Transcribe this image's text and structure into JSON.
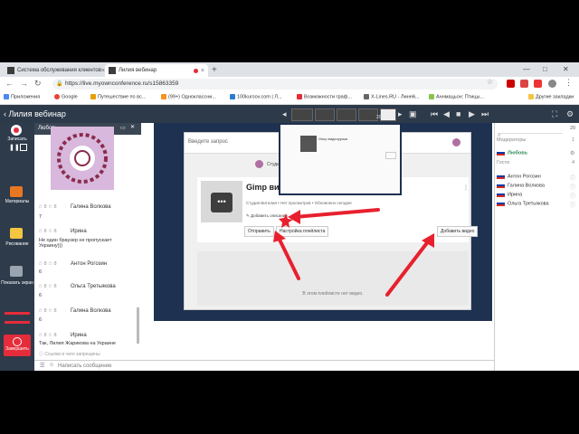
{
  "browser": {
    "tabs": [
      {
        "title": "Система обслуживания клиентов",
        "active": false
      },
      {
        "title": "Лилия вебинар",
        "active": true
      }
    ],
    "url": "https://live.myownconference.ru/s15863359",
    "bookmarks": [
      "Приложения",
      "Google",
      "Путешествие по вс...",
      "(99+) Одноклассни...",
      "100kursov.com | Л...",
      "Возможности граф...",
      "X-Lines.RU - Линей...",
      "Аннмацьон: Птицы...",
      "Другие закладки"
    ]
  },
  "app": {
    "title": "Лилия вебинар",
    "page_counter": "20",
    "left_toolbar": [
      "Записать",
      "Материалы",
      "Рисование",
      "Показать экран",
      "Завершить"
    ]
  },
  "chat": {
    "header": "Любовь",
    "messages": [
      {
        "name": "Галина Волкова",
        "text": "7"
      },
      {
        "name": "Ирина",
        "text": "Не один браузер не пропускает Украину)))"
      },
      {
        "name": "Антон Рогозин",
        "text": "6"
      },
      {
        "name": "Ольга Третьякова",
        "text": "6"
      },
      {
        "name": "Галина Волкова",
        "text": "6"
      },
      {
        "name": "Ирина",
        "text": "Так, Лилия Жарикова на Украине"
      }
    ],
    "footer_note": "Ссылки в чате запрещены",
    "input_placeholder": "Написать сообщение"
  },
  "slide": {
    "search_placeholder": "Введите запрос",
    "channel_title": "Студия видео",
    "video_title": "Gimp видеоуроки",
    "meta": "Студия Виталия • Нет просмотров • Обновлено сегодня",
    "add_description": "Добавить описание",
    "send_btn": "Отправить",
    "settings_btn": "Настройка плейлиста",
    "add_video_btn": "Добавить видео",
    "empty_msg": "В этом плейлисте нет видео.",
    "popup_title": "Gimp видеоуроки"
  },
  "participants": {
    "moderators_label": "Модераторы",
    "moderators_count": "1",
    "moderators": [
      "Любовь"
    ],
    "guests_label": "Гости",
    "guests_count": "4",
    "guests": [
      "Антон Рогозин",
      "Галина Волкова",
      "Ирина",
      "Ольга Третьякова"
    ],
    "total": "20"
  },
  "colors": {
    "accent": "#e52c3a",
    "header": "#2d3a4a",
    "moderator": "#2e8b57"
  }
}
